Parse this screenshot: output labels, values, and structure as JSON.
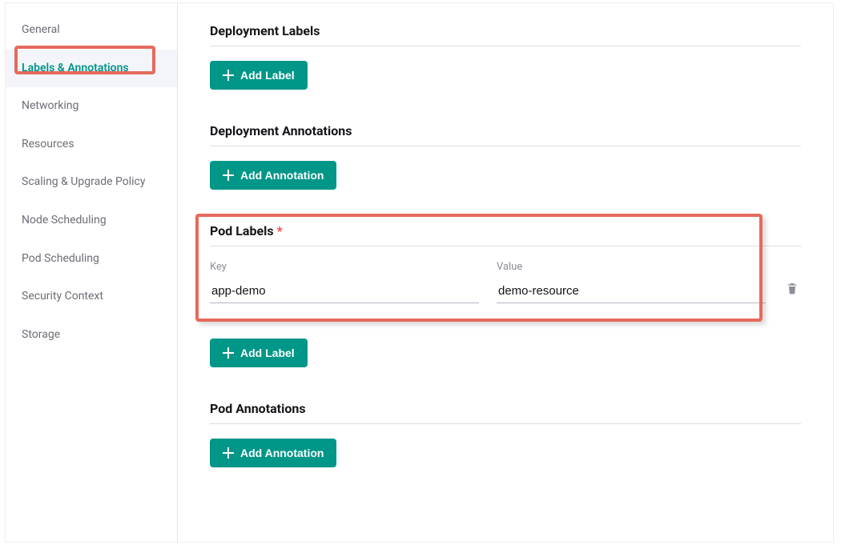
{
  "sidebar": {
    "items": [
      {
        "label": "General",
        "active": false
      },
      {
        "label": "Labels & Annotations",
        "active": true
      },
      {
        "label": "Networking",
        "active": false
      },
      {
        "label": "Resources",
        "active": false
      },
      {
        "label": "Scaling & Upgrade Policy",
        "active": false
      },
      {
        "label": "Node Scheduling",
        "active": false
      },
      {
        "label": "Pod Scheduling",
        "active": false
      },
      {
        "label": "Security Context",
        "active": false
      },
      {
        "label": "Storage",
        "active": false
      }
    ]
  },
  "sections": {
    "deployment_labels": {
      "title": "Deployment Labels",
      "add_button": "Add Label"
    },
    "deployment_annotations": {
      "title": "Deployment Annotations",
      "add_button": "Add Annotation"
    },
    "pod_labels": {
      "title": "Pod Labels",
      "required_marker": "*",
      "key_label": "Key",
      "value_label": "Value",
      "rows": [
        {
          "key": "app-demo",
          "value": "demo-resource"
        }
      ],
      "add_button": "Add Label"
    },
    "pod_annotations": {
      "title": "Pod Annotations",
      "add_button": "Add Annotation"
    }
  },
  "colors": {
    "accent": "#009688",
    "highlight": "#e66a5c"
  }
}
